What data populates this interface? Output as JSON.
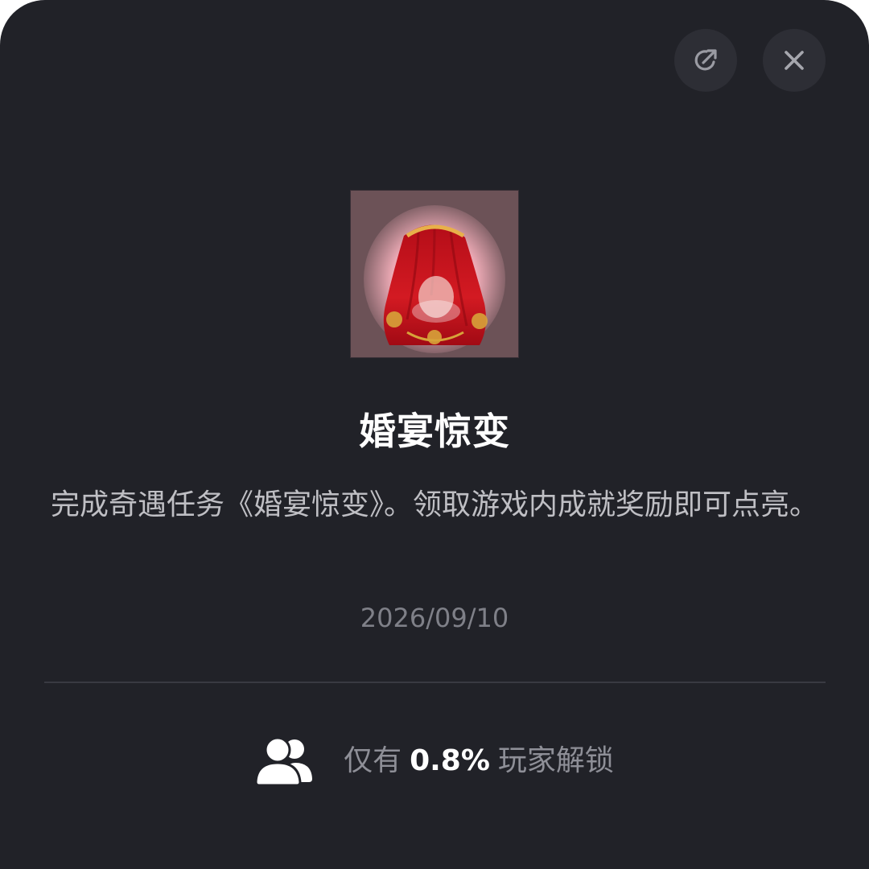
{
  "header": {
    "share_icon": "share-icon",
    "close_icon": "close-icon"
  },
  "achievement": {
    "badge_icon": "bride-red-veil-icon",
    "title": "婚宴惊变",
    "description": "完成奇遇任务《婚宴惊变》。领取游戏内成就奖励即可点亮。",
    "date": "2026/09/10"
  },
  "stats": {
    "icon": "users-icon",
    "prefix": "仅有",
    "percent": "0.8%",
    "suffix": "玩家解锁"
  },
  "colors": {
    "background": "#212228",
    "button_bg": "#2d2e35",
    "title": "#ffffff",
    "description": "#bfbfc4",
    "date": "#7f8088",
    "divider": "#393a42"
  }
}
